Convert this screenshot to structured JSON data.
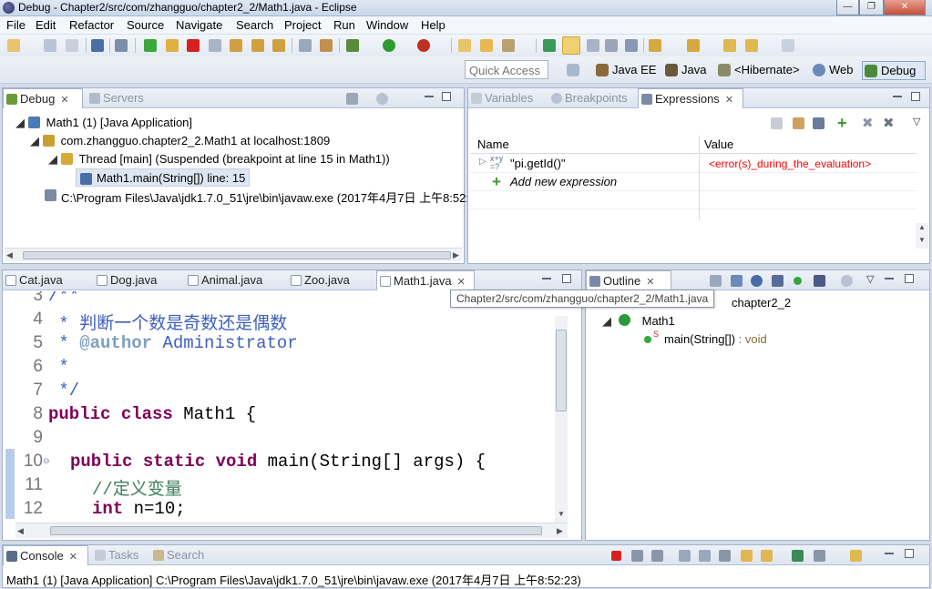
{
  "window": {
    "title": "Debug - Chapter2/src/com/zhangguo/chapter2_2/Math1.java - Eclipse",
    "min": "—",
    "restore": "❐",
    "close": "✕"
  },
  "menu": [
    "File",
    "Edit",
    "Refactor",
    "Source",
    "Navigate",
    "Search",
    "Project",
    "Run",
    "Window",
    "Help"
  ],
  "quick_access": {
    "placeholder": "Quick Access"
  },
  "perspectives": [
    {
      "label": "Java EE"
    },
    {
      "label": "Java"
    },
    {
      "label": "<Hibernate>"
    },
    {
      "label": "Web"
    },
    {
      "label": "Debug"
    }
  ],
  "debug_view": {
    "tabs": [
      {
        "label": "Debug"
      },
      {
        "label": "Servers"
      }
    ],
    "tree": [
      {
        "label": "Math1 (1) [Java Application]"
      },
      {
        "label": "com.zhangguo.chapter2_2.Math1 at localhost:1809"
      },
      {
        "label": "Thread [main] (Suspended (breakpoint at line 15 in Math1))"
      },
      {
        "label": "Math1.main(String[]) line: 15"
      },
      {
        "label": "C:\\Program Files\\Java\\jdk1.7.0_51\\jre\\bin\\javaw.exe (2017年4月7日 上午8:52:"
      }
    ]
  },
  "expressions_view": {
    "tabs": [
      {
        "label": "Variables"
      },
      {
        "label": "Breakpoints"
      },
      {
        "label": "Expressions"
      }
    ],
    "columns": [
      "Name",
      "Value"
    ],
    "rows": [
      {
        "name": "\"pi.getId()\"",
        "value": "<error(s)_during_the_evaluation>"
      }
    ],
    "add_label": "Add new expression",
    "error_color": "#ff0000"
  },
  "editor": {
    "tabs": [
      {
        "label": "Cat.java"
      },
      {
        "label": "Dog.java"
      },
      {
        "label": "Animal.java"
      },
      {
        "label": "Zoo.java"
      },
      {
        "label": "Math1.java"
      }
    ],
    "tooltip": "Chapter2/src/com/zhangguo/chapter2_2/Math1.java",
    "lines": [
      {
        "n": "3",
        "t1": "/**",
        "t2": ""
      },
      {
        "n": "4",
        "t1": " * 判断一个数是奇数还是偶数",
        "t2": ""
      },
      {
        "n": "5",
        "t1": " * ",
        "t2": "@author",
        "t3": " Administrator"
      },
      {
        "n": "6",
        "t1": " *",
        "t2": ""
      },
      {
        "n": "7",
        "t1": " */",
        "t2": ""
      },
      {
        "n": "8",
        "kw": "public class",
        "rest": " Math1 {"
      },
      {
        "n": "9",
        "t1": "",
        "t2": ""
      },
      {
        "n": "10",
        "kw": "public static void",
        "rest": " main(String[] args) {"
      },
      {
        "n": "11",
        "cm": "//定义变量"
      },
      {
        "n": "12",
        "kw": "int",
        "rest": " n=10;"
      }
    ]
  },
  "outline_view": {
    "tab": {
      "label": "Outline"
    },
    "items": [
      {
        "label": "chapter2_2"
      },
      {
        "label": "Math1"
      },
      {
        "label": "main(String[])",
        "type": " : void"
      }
    ]
  },
  "console_view": {
    "tabs": [
      {
        "label": "Console"
      },
      {
        "label": "Tasks"
      },
      {
        "label": "Search"
      }
    ],
    "text": "Math1 (1) [Java Application] C:\\Program Files\\Java\\jdk1.7.0_51\\jre\\bin\\javaw.exe (2017年4月7日 上午8:52:23)"
  }
}
